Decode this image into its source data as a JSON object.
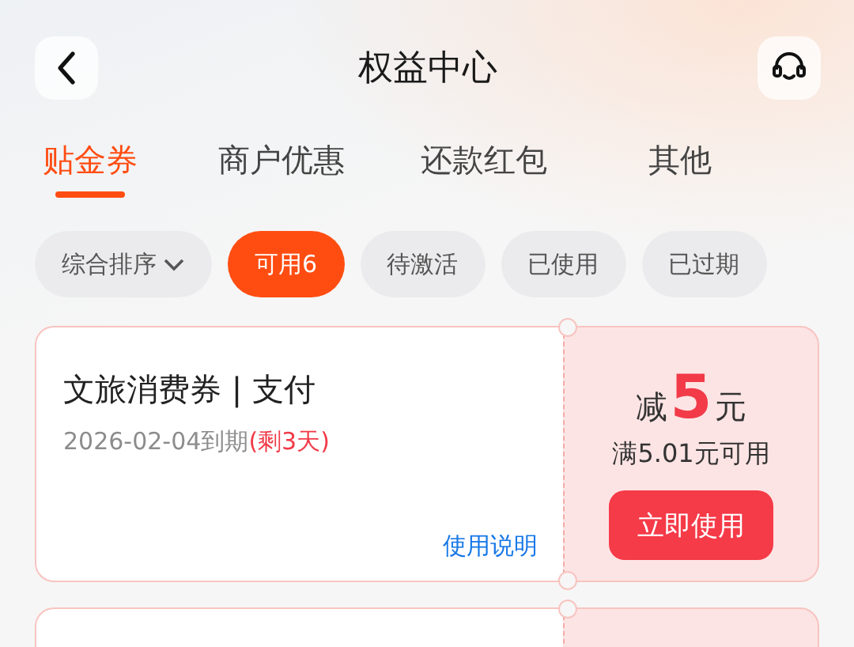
{
  "header": {
    "title": "权益中心"
  },
  "tabs": [
    {
      "label": "贴金券",
      "selected": true
    },
    {
      "label": "商户优惠",
      "selected": false
    },
    {
      "label": "还款红包",
      "selected": false
    },
    {
      "label": "其他",
      "selected": false
    }
  ],
  "filters": [
    {
      "label": "综合排序",
      "kind": "dropdown",
      "selected": false
    },
    {
      "label": "可用6",
      "kind": "chip",
      "selected": true
    },
    {
      "label": "待激活",
      "kind": "chip",
      "selected": false
    },
    {
      "label": "已使用",
      "kind": "chip",
      "selected": false
    },
    {
      "label": "已过期",
      "kind": "chip",
      "selected": false
    }
  ],
  "coupons": [
    {
      "title": "文旅消费券 | 支付",
      "expiry": "2026-02-04到期",
      "remaining": "(剩3天)",
      "prefix": "减",
      "amount": "5",
      "unit": "元",
      "condition": "满5.01元可用",
      "button": "立即使用",
      "link": "使用说明"
    }
  ]
}
